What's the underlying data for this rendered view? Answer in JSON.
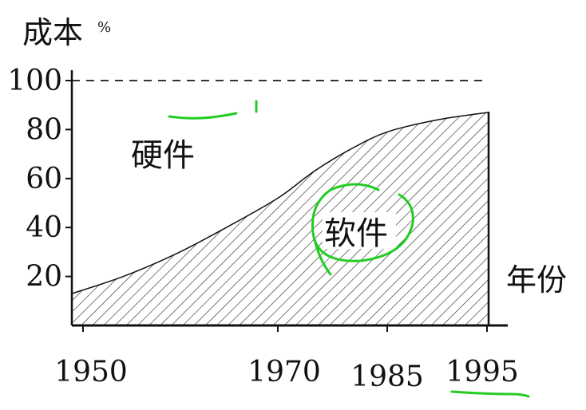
{
  "chart_data": {
    "type": "area",
    "ylabel": "成本",
    "yunit": "%",
    "xlabel": "年份",
    "yticks": [
      20,
      40,
      60,
      80,
      100
    ],
    "xticks": [
      "1950",
      "1970",
      "1985",
      "1995"
    ],
    "ylim": [
      0,
      100
    ],
    "xlim": [
      1950,
      1995
    ],
    "reference_line": 100,
    "regions": {
      "upper": "硬件",
      "lower": "软件"
    },
    "series": [
      {
        "x": [
          1950,
          1955,
          1960,
          1965,
          1970,
          1975,
          1980,
          1985,
          1990,
          1995
        ],
        "y": [
          13,
          20,
          29,
          40,
          52,
          63,
          72,
          79,
          84,
          87
        ]
      }
    ],
    "colors": {
      "axis": "#111111",
      "hatch": "#222222",
      "annotation": "#22cc22"
    }
  }
}
